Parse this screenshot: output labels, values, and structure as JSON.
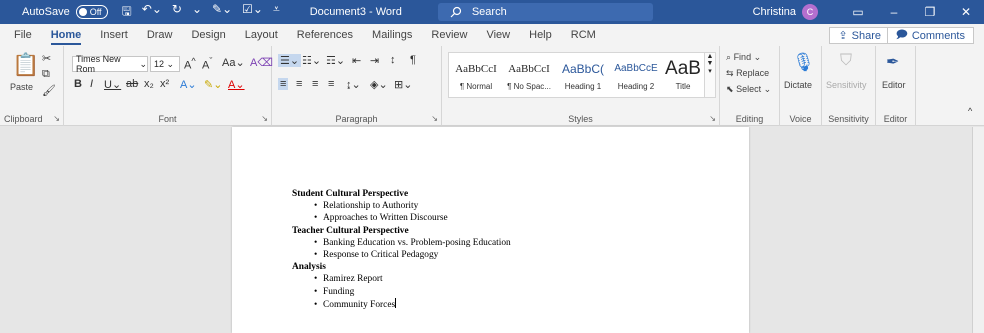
{
  "titlebar": {
    "autosave_label": "AutoSave",
    "autosave_state": "Off",
    "doc_title": "Document3 - Word",
    "search_placeholder": "Search",
    "user_name": "Christina",
    "user_initial": "C"
  },
  "tabs": [
    "File",
    "Home",
    "Insert",
    "Draw",
    "Design",
    "Layout",
    "References",
    "Mailings",
    "Review",
    "View",
    "Help",
    "RCM"
  ],
  "active_tab": "Home",
  "share_label": "Share",
  "comments_label": "Comments",
  "ribbon": {
    "clipboard": {
      "label": "Clipboard",
      "paste": "Paste"
    },
    "font": {
      "label": "Font",
      "name": "Times New Rom",
      "size": "12"
    },
    "paragraph": {
      "label": "Paragraph"
    },
    "styles": {
      "label": "Styles",
      "items": [
        {
          "preview": "AaBbCcI",
          "name": "¶ Normal"
        },
        {
          "preview": "AaBbCcI",
          "name": "¶ No Spac..."
        },
        {
          "preview": "AaBbC(",
          "name": "Heading 1"
        },
        {
          "preview": "AaBbCcE",
          "name": "Heading 2"
        },
        {
          "preview": "AaB",
          "name": "Title"
        }
      ]
    },
    "editing": {
      "label": "Editing",
      "find": "Find",
      "replace": "Replace",
      "select": "Select"
    },
    "voice": {
      "label": "Voice",
      "dictate": "Dictate"
    },
    "sensitivity": {
      "label": "Sensitivity",
      "button": "Sensitivity"
    },
    "editor": {
      "label": "Editor",
      "button": "Editor"
    }
  },
  "document": {
    "sections": [
      {
        "heading": "Student Cultural Perspective",
        "bullets": [
          "Relationship to Authority",
          "Approaches to Written Discourse"
        ]
      },
      {
        "heading": "Teacher Cultural Perspective",
        "bullets": [
          "Banking Education vs. Problem-posing Education",
          "Response to Critical Pedagogy"
        ]
      },
      {
        "heading": "Analysis",
        "bullets": [
          "Ramirez Report",
          "Funding",
          "Community Forces"
        ]
      }
    ]
  },
  "colors": {
    "accent": "#2b579a",
    "avatar": "#b46fcf"
  }
}
